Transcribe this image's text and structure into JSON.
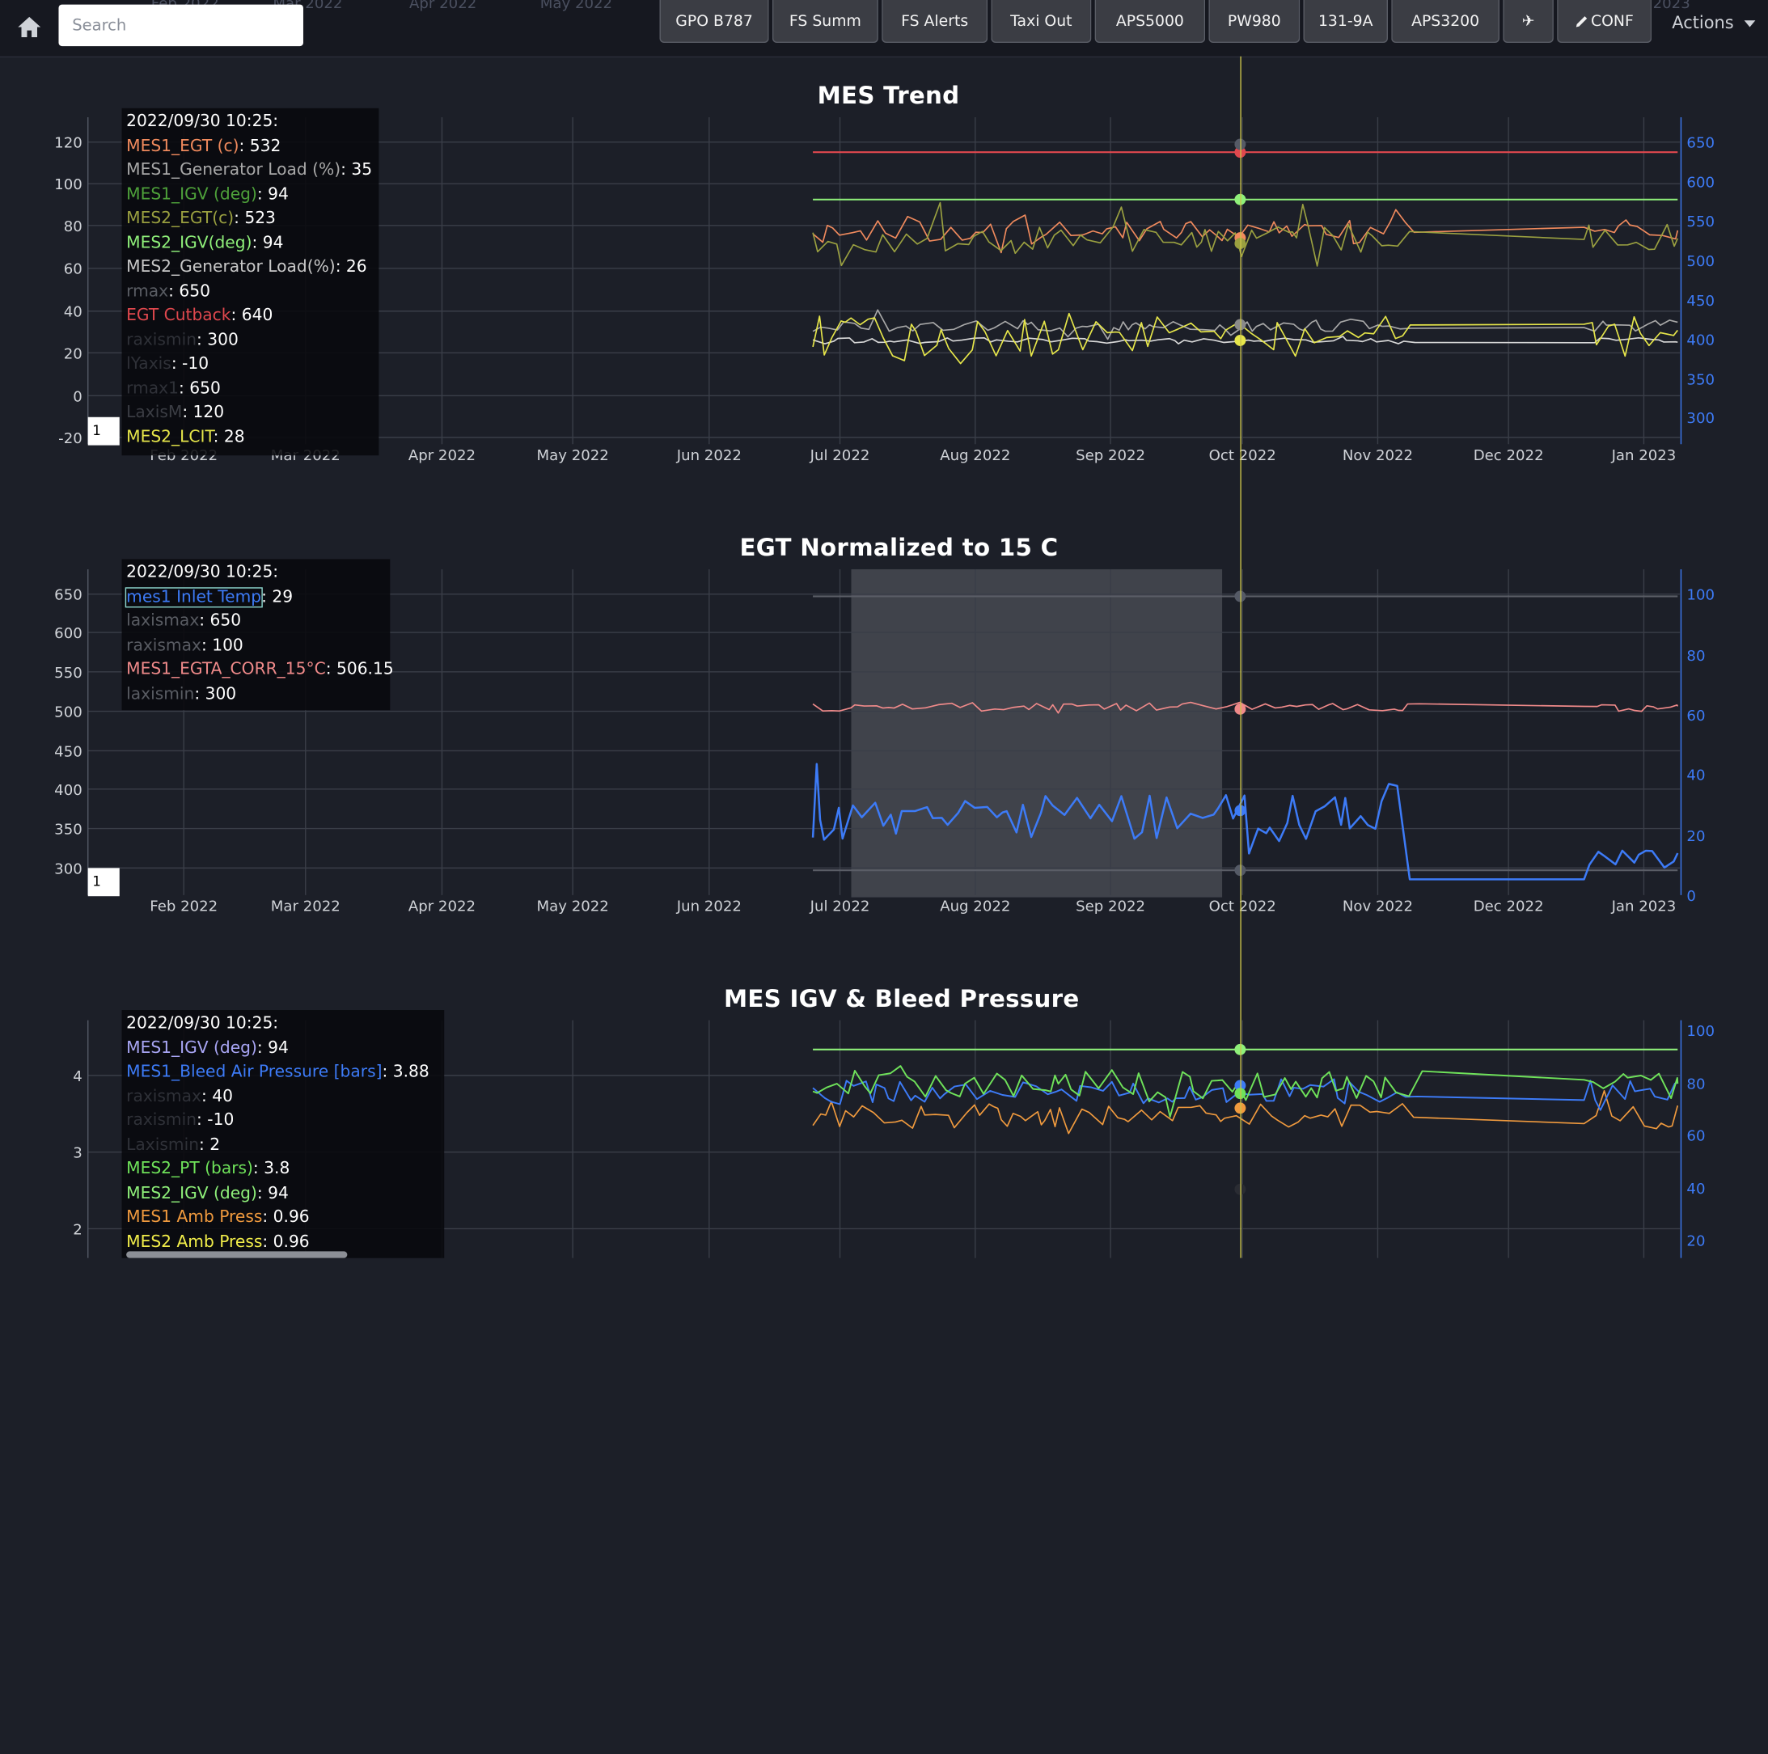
{
  "search": {
    "placeholder": "Search"
  },
  "ghost_ticks": [
    "Feb 2022",
    "Mar 2022",
    "Apr 2022",
    "May 2022",
    "2023"
  ],
  "nav_buttons": [
    "GPO B787",
    "FS Summ",
    "FS Alerts",
    "Taxi Out",
    "APS5000",
    "PW980",
    "131-9A",
    "APS3200",
    "✈",
    "CONF"
  ],
  "actions_label": "Actions",
  "x_ticks": [
    "Feb 2022",
    "Mar 2022",
    "Apr 2022",
    "May 2022",
    "Jun 2022",
    "Jul 2022",
    "Aug 2022",
    "Sep 2022",
    "Oct 2022",
    "Nov 2022",
    "Dec 2022",
    "Jan 2023"
  ],
  "colors": {
    "background": "#1c1f28",
    "accent_blue": "#3d7bf7",
    "cursor_yellow": "#c9c34a"
  },
  "charts": [
    {
      "title": "MES Trend",
      "page_box": "1",
      "left_ticks": [
        "120",
        "100",
        "80",
        "60",
        "40",
        "20",
        "0",
        "-20"
      ],
      "right_ticks": [
        "650",
        "600",
        "550",
        "500",
        "450",
        "400",
        "350",
        "300"
      ],
      "tooltip": {
        "date": "2022/09/30 10:25:",
        "rows": [
          {
            "label": "MES1_EGT (c)",
            "value": ": 532",
            "color": "#f08a5d"
          },
          {
            "label": "MES1_Generator Load (%)",
            "value": ": 35",
            "color": "#a8a8a8"
          },
          {
            "label": "MES1_IGV (deg)",
            "value": ": 94",
            "color": "#4ea13a"
          },
          {
            "label": "MES2_EGT(c)",
            "value": ": 523",
            "color": "#9aa040"
          },
          {
            "label": "MES2_IGV(deg)",
            "value": ": 94",
            "color": "#8ff07a"
          },
          {
            "label": "MES2_Generator Load(%)",
            "value": ": 26",
            "color": "#c8c8c8"
          },
          {
            "label": "rmax",
            "value": ": 650",
            "color": "#595c63"
          },
          {
            "label": "EGT Cutback",
            "value": ": 640",
            "color": "#e0484e"
          },
          {
            "label": "raxismin",
            "value": ": 300",
            "color": "#2f3138"
          },
          {
            "label": "lYaxis",
            "value": ": -10",
            "color": "#2f3138"
          },
          {
            "label": "rmax1",
            "value": ": 650",
            "color": "#2f3138"
          },
          {
            "label": "LaxisM",
            "value": ": 120",
            "color": "#3b3d44"
          },
          {
            "label": "MES2_LCIT",
            "value": ": 28",
            "color": "#e6e64a"
          }
        ]
      }
    },
    {
      "title": "EGT Normalized to 15 C",
      "page_box": "1",
      "left_ticks": [
        "650",
        "600",
        "550",
        "500",
        "450",
        "400",
        "350",
        "300"
      ],
      "right_ticks": [
        "100",
        "80",
        "60",
        "40",
        "20",
        "0"
      ],
      "tooltip": {
        "date": "2022/09/30 10:25:",
        "rows": [
          {
            "label": "mes1 Inlet Temp",
            "value": ": 29",
            "color": "#3d7bf7"
          },
          {
            "label": "laxismax",
            "value": ": 650",
            "color": "#595c63"
          },
          {
            "label": "raxismax",
            "value": ": 100",
            "color": "#595c63"
          },
          {
            "label": "MES1_EGTA_CORR_15°C",
            "value": ": 506.15",
            "color": "#f08a8a"
          },
          {
            "label": "laxismin",
            "value": ": 300",
            "color": "#595c63"
          }
        ]
      }
    },
    {
      "title": "MES IGV & Bleed Pressure",
      "left_ticks": [
        "4",
        "3",
        "2"
      ],
      "right_ticks": [
        "100",
        "80",
        "60",
        "40",
        "20"
      ],
      "tooltip": {
        "date": "2022/09/30 10:25:",
        "rows": [
          {
            "label": "MES1_IGV (deg)",
            "value": ": 94",
            "color": "#a9a6f5"
          },
          {
            "label": "MES1_Bleed Air Pressure [bars]",
            "value": ": 3.88",
            "color": "#3d7bf7"
          },
          {
            "label": "raxismax",
            "value": ": 40",
            "color": "#2f3138"
          },
          {
            "label": "raxismin",
            "value": ": -10",
            "color": "#2f3138"
          },
          {
            "label": "Laxismin",
            "value": ": 2",
            "color": "#2f3138"
          },
          {
            "label": "MES2_PT (bars)",
            "value": ": 3.8",
            "color": "#6fe25a"
          },
          {
            "label": "MES2_IGV (deg)",
            "value": ": 94",
            "color": "#8ff07a"
          },
          {
            "label": "MES1 Amb Press",
            "value": ": 0.96",
            "color": "#f09a3e"
          },
          {
            "label": "MES2 Amb Press",
            "value": ": 0.96",
            "color": "#f2ee4a"
          }
        ]
      }
    }
  ]
}
